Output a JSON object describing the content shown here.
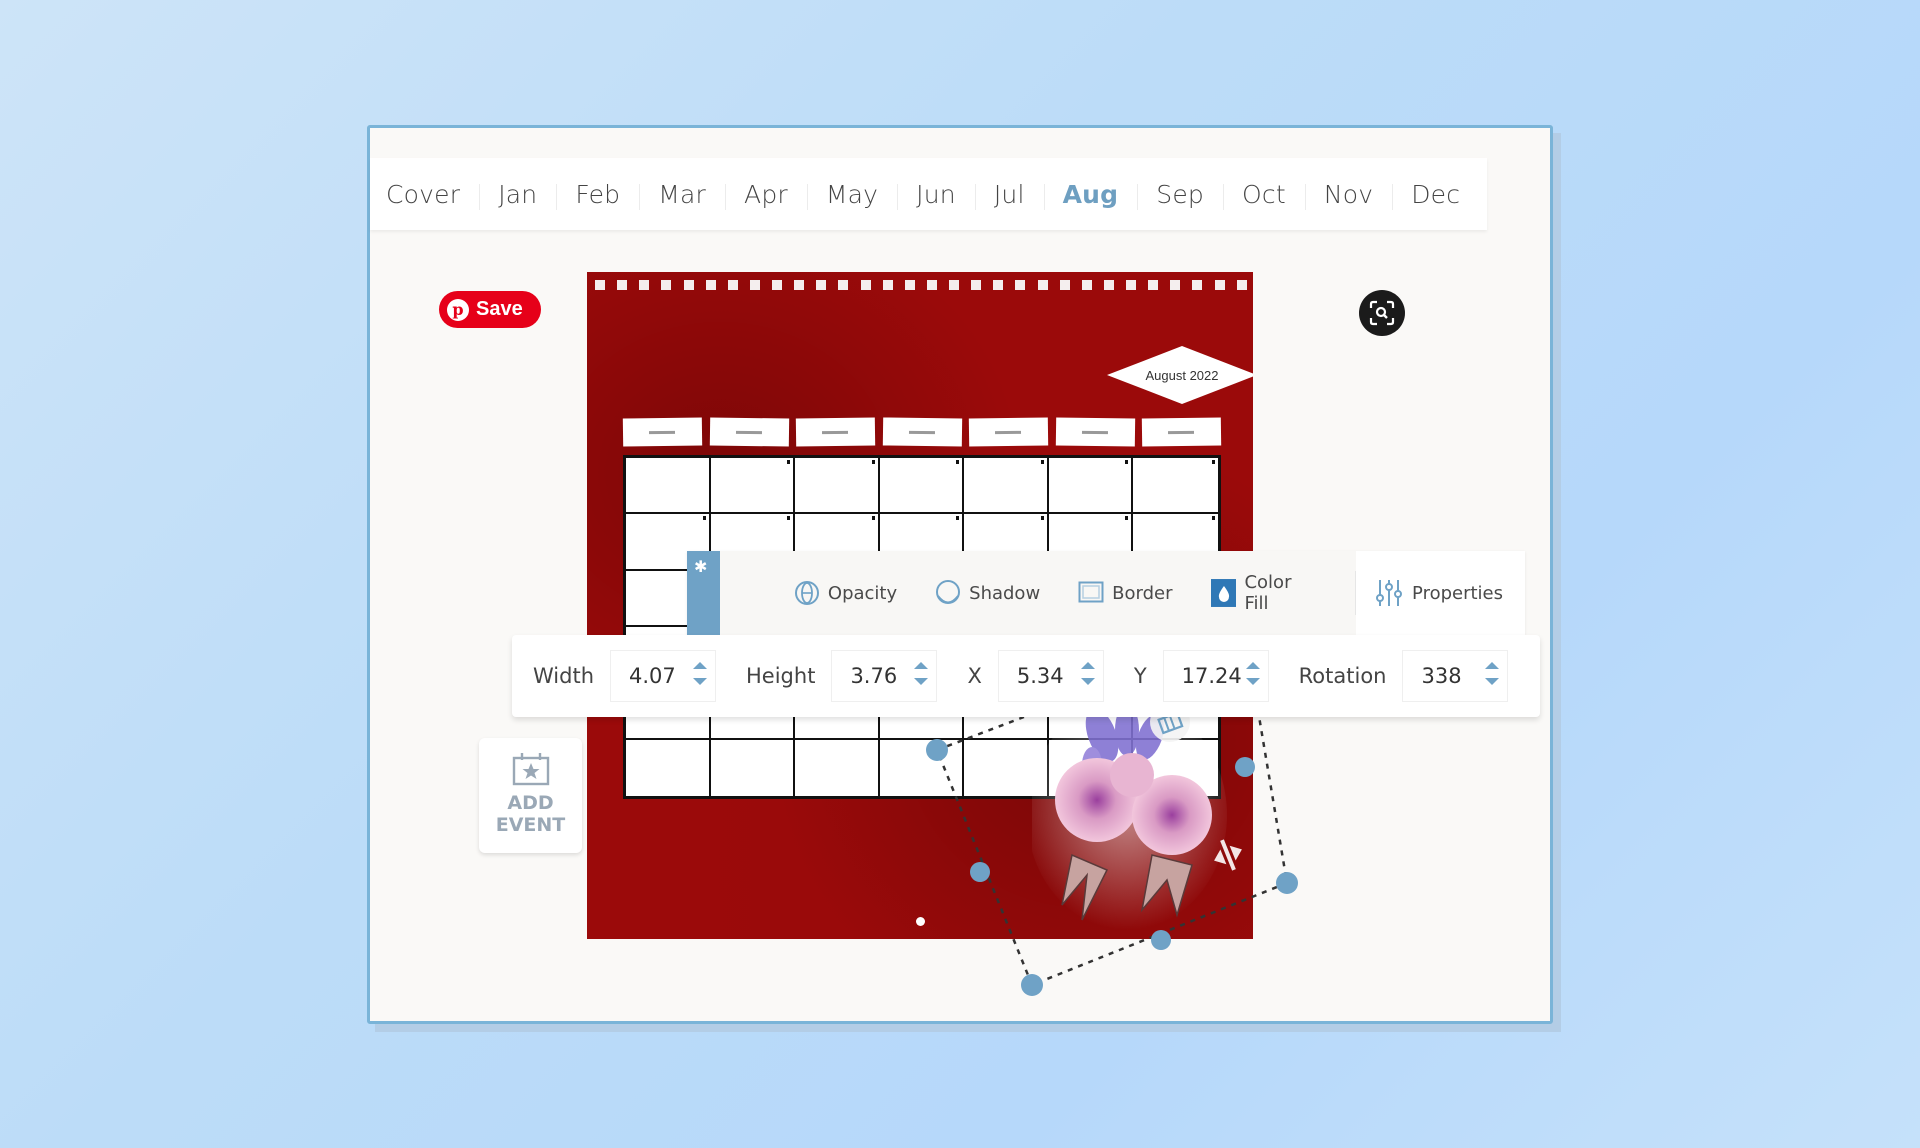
{
  "tabs": {
    "items": [
      "Cover",
      "Jan",
      "Feb",
      "Mar",
      "Apr",
      "May",
      "Jun",
      "Jul",
      "Aug",
      "Sep",
      "Oct",
      "Nov",
      "Dec"
    ],
    "active": "Aug"
  },
  "pinterest": {
    "label": "Save",
    "icon": "pinterest-icon"
  },
  "lens": {
    "icon": "visual-search-icon"
  },
  "calendar": {
    "title": "August 2022",
    "rows": 6,
    "columns": 7
  },
  "toolbar": {
    "pin_icon": "pin-icon",
    "items": [
      {
        "label": "Opacity",
        "icon": "opacity-icon"
      },
      {
        "label": "Shadow",
        "icon": "shadow-icon"
      },
      {
        "label": "Border",
        "icon": "border-icon"
      },
      {
        "label": "Color Fill",
        "icon": "color-fill-icon"
      }
    ],
    "properties": {
      "label": "Properties",
      "icon": "sliders-icon"
    }
  },
  "properties": {
    "width": {
      "label": "Width",
      "value": "4.07"
    },
    "height": {
      "label": "Height",
      "value": "3.76"
    },
    "x": {
      "label": "X",
      "value": "5.34"
    },
    "y": {
      "label": "Y",
      "value": "17.24"
    },
    "rotation": {
      "label": "Rotation",
      "value": "338"
    }
  },
  "add_event": {
    "line1": "ADD",
    "line2": "EVENT",
    "icon": "calendar-star-icon"
  },
  "colors": {
    "accent": "#6fa2c6",
    "active_tab": "#6e9fc1",
    "pinterest_red": "#e60019",
    "calendar_red": "#9b0a0a",
    "window_border": "#7ab4d8"
  }
}
